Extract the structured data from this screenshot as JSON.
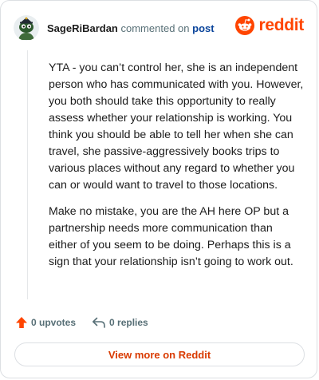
{
  "header": {
    "username": "SageRiBardan",
    "action_text": "commented on",
    "link_text": "post",
    "brand_wordmark": "reddit"
  },
  "comment": {
    "paragraphs": [
      "YTA - you can’t control her, she is an independent person who has communicated with you. However, you both should take this opportunity to really assess whether your relationship is working. You think you should be able to tell her when she can travel, she passive-aggressively books trips to various places without any regard to whether you can or would want to travel to those locations.",
      "Make no mistake, you are the AH here OP but a partnership needs more communication than either of you seem to be doing. Perhaps this is a sign that your relationship isn’t going to work out."
    ]
  },
  "actions": {
    "upvotes_label": "0 upvotes",
    "replies_label": "0 replies"
  },
  "footer": {
    "view_more_label": "View more on Reddit"
  },
  "icons": {
    "upvote": "upvote-arrow-icon",
    "reply": "reply-arrow-icon",
    "brand": "reddit-snoo-icon",
    "avatar": "snoo-avatar"
  },
  "colors": {
    "brand_orange": "#ff4500",
    "link_blue": "#0a449b",
    "button_text": "#d93a00",
    "muted_text": "#576f76",
    "border": "#dcdfe3"
  }
}
